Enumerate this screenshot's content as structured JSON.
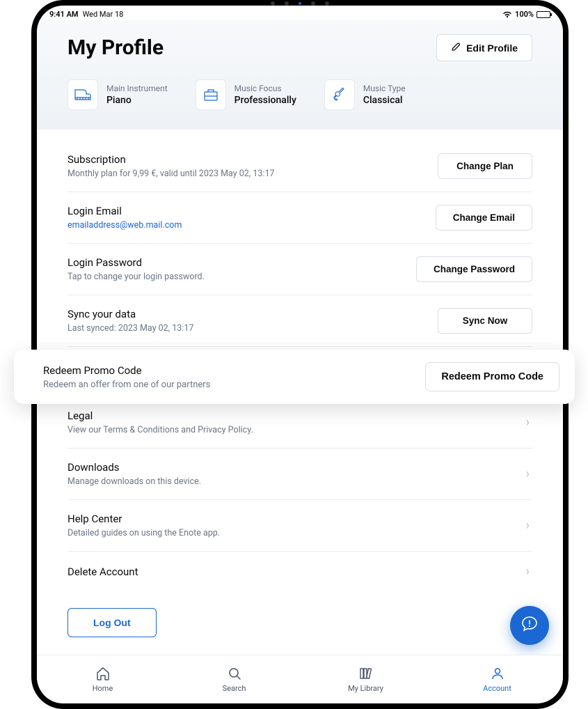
{
  "status": {
    "time": "9:41 AM",
    "date": "Wed Mar 18",
    "battery_pct": "100%"
  },
  "header": {
    "title": "My Profile",
    "edit_label": "Edit Profile",
    "cards": {
      "instrument": {
        "label": "Main Instrument",
        "value": "Piano"
      },
      "focus": {
        "label": "Music Focus",
        "value": "Professionally"
      },
      "genre": {
        "label": "Music Type",
        "value": "Classical"
      }
    }
  },
  "rows": {
    "subscription": {
      "title": "Subscription",
      "sub": "Monthly plan for 9,99 €, valid until 2023 May 02, 13:17",
      "button": "Change Plan"
    },
    "email": {
      "title": "Login Email",
      "sub": "emailaddress@web.mail.com",
      "button": "Change Email"
    },
    "password": {
      "title": "Login Password",
      "sub": "Tap to change your login password.",
      "button": "Change Password"
    },
    "sync": {
      "title": "Sync your data",
      "sub": "Last synced: 2023 May 02, 13:17",
      "button": "Sync Now"
    },
    "legal": {
      "title": "Legal",
      "sub": "View our Terms & Conditions and Privacy Policy."
    },
    "downloads": {
      "title": "Downloads",
      "sub": "Manage downloads on this device."
    },
    "help": {
      "title": "Help Center",
      "sub": "Detailed guides on using the Enote app."
    },
    "delete": {
      "title": "Delete Account"
    }
  },
  "redeem": {
    "title": "Redeem Promo Code",
    "sub": "Redeem an offer from one of our partners",
    "button": "Redeem Promo Code"
  },
  "logout_label": "Log Out",
  "tabs": {
    "home": "Home",
    "search": "Search",
    "library": "My Library",
    "account": "Account"
  }
}
